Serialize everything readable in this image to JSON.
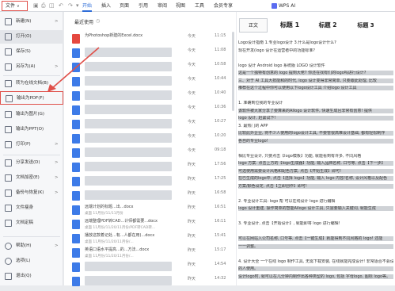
{
  "ribbon": {
    "file_label": "文件",
    "tabs": [
      "开始",
      "插入",
      "页面",
      "引用",
      "审阅",
      "视图",
      "工具",
      "会员专享"
    ],
    "active_tab": "开始",
    "wps_ai": "WPS AI"
  },
  "menu": {
    "items": [
      {
        "label": "新建(N)",
        "arrow": ">"
      },
      {
        "label": "打开(O)",
        "arrow": ""
      },
      {
        "label": "保存(S)",
        "arrow": ""
      },
      {
        "label": "另存为(A)",
        "arrow": ">"
      },
      {
        "label": "转为在线文档(B)",
        "arrow": ""
      },
      {
        "label": "输出为PDF(F)",
        "arrow": ""
      },
      {
        "label": "输出为图片(G)",
        "arrow": ""
      },
      {
        "label": "输出为PPT(O)",
        "arrow": ""
      },
      {
        "label": "打印(P)",
        "arrow": ">"
      },
      {
        "label": "分享发送(D)",
        "arrow": ">"
      },
      {
        "label": "文档加密(E)",
        "arrow": ">"
      },
      {
        "label": "备份与恢复(K)",
        "arrow": ">"
      },
      {
        "label": "文件瘦身",
        "arrow": ""
      },
      {
        "label": "文档定稿",
        "arrow": ""
      },
      {
        "label": "帮助(H)",
        "arrow": ">"
      },
      {
        "label": "选项(L)",
        "arrow": ""
      },
      {
        "label": "退出(Q)",
        "arrow": ""
      }
    ]
  },
  "recent": {
    "title": "最近使用",
    "files": [
      {
        "name": "为Photoshop新建的Excel.docx",
        "path": "",
        "date": "今天",
        "time": "11:15",
        "type": "pdf"
      },
      {
        "name": "",
        "path": "",
        "date": "今天",
        "time": "11:08",
        "type": "word"
      },
      {
        "name": "",
        "path": "",
        "date": "今天",
        "time": "10:58",
        "type": "word"
      },
      {
        "name": "",
        "path": "",
        "date": "今天",
        "time": "10:44",
        "type": "word"
      },
      {
        "name": "",
        "path": "",
        "date": "今天",
        "time": "10:40",
        "type": "word"
      },
      {
        "name": "",
        "path": "",
        "date": "今天",
        "time": "10:36",
        "type": "word"
      },
      {
        "name": "",
        "path": "",
        "date": "今天",
        "time": "10:27",
        "type": "word"
      },
      {
        "name": "",
        "path": "",
        "date": "今天",
        "time": "10:20",
        "type": "word"
      },
      {
        "name": "",
        "path": "",
        "date": "今天",
        "time": "09:18",
        "type": "word"
      },
      {
        "name": "",
        "path": "",
        "date": "昨天",
        "time": "17:56",
        "type": "word"
      },
      {
        "name": "",
        "path": "",
        "date": "昨天",
        "time": "17:25",
        "type": "word"
      },
      {
        "name": "",
        "path": "",
        "date": "昨天",
        "time": "16:58",
        "type": "word"
      },
      {
        "name": "远端计划的标题...出...docx",
        "path": "桌面 11月份/11/11月份",
        "date": "昨天",
        "time": "16:51",
        "type": "word"
      },
      {
        "name": "远端整理PDF转CAD...计师都需要...docx",
        "path": "桌面 11月份/11/20/11月份/PDF转CAD转...",
        "date": "昨天",
        "time": "16:11",
        "type": "word"
      },
      {
        "name": "播放这款着记处...有...人都在用)...docx",
        "path": "桌面 11月份/11/20/11月份/...",
        "date": "昨天",
        "time": "15:41",
        "type": "word"
      },
      {
        "name": "英语口语水平提高...的...方法...docx",
        "path": "桌面 11月份/11/20/11月份/...",
        "date": "昨天",
        "time": "15:17",
        "type": "word"
      },
      {
        "name": "",
        "path": "",
        "date": "昨天",
        "time": "14:54",
        "type": "word"
      },
      {
        "name": "",
        "path": "",
        "date": "昨天",
        "time": "14:32",
        "type": "word"
      }
    ]
  },
  "document": {
    "style_normal": "正文",
    "style_h1": "标题 1",
    "style_h2": "标题 2",
    "style_h3": "标题 3",
    "lines": [
      "Logo设计指南 1.专业logo设计 3.什么是logo设计什么?",
      "现在开发(logo 设计在运营者中的功能标准?",
      "",
      "logo 设计 Android logo 系统版 LOGO 设计软件",
      "这是一个独特有创意的 logo 提到大佬? 你还在找有们的logo吗进行设计?",
      "三、对于 AI 工具大技能和的时代, logo 设计变得非常简单, 只要跟此处理, 比较",
      "推荐在这个过程中你可以使用以下logo设计工具 介绍logo 设计工具",
      "",
      "1. 准确到位我的专业设计",
      "该软件被大家分享了要算来的AIlogo 设计软件, 快速生成且非常有创意! 提供",
      "logo 设计, 赶紧试下!",
      "3. 最热门的 APP",
      "比较此外企业, 将不少人使用的logo设计工具, 不要管很高难设计基础, 都有轻松制作",
      "各自的专业logo!",
      "",
      "相比专业设计, 只要点击【logo模板】功能, 就能看到有许多, 不同风格",
      "logo 方案. 点击上方的【logo生成器】功能, 输入品牌名称, 口号等, 点击【下一步】",
      "可选使用需要设计风格和配色方案, 点击【开始生成】即可!",
      "在已生成的logo中, 点击【选择 logo】功能, 输入 logo 内容/名称, 设计风格以及配色",
      "方案/颜色设定, 点击【立即创作】即可!",
      "",
      "2. 专业设计工具: logo 帮 可以在线设计 logo 进行编辑",
      "logo 设计重建, 操作简单的智能Ailogo 设计工具, 只需要输入关键词, 就能生成",
      "",
      "3. 专业设计, 点击【开始设计】, 就能即将 logo 进行编辑!",
      "",
      "可以在网站入公司名称, 口号等, 点击【一键生成】就能得到不同风格的 logo! 还能",
      "一一调整。",
      "",
      "4. 设计大全 一个在线 logo 制作工具, 无需下载安装, 在线就能完成设计! 非常适合不会设计",
      "的人使用。",
      "设计logo时, 就可以在几分钟内制作出各种类型的 logo, 包括 字母logo, 图标 logo等。"
    ],
    "highlighted": [
      4,
      5,
      6,
      9,
      10,
      12,
      13,
      16,
      17,
      18,
      19,
      22,
      26,
      27,
      30,
      31
    ]
  }
}
